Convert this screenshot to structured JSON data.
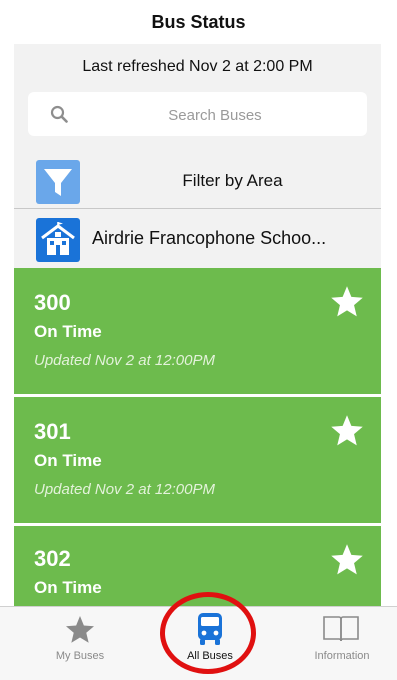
{
  "header": {
    "title": "Bus Status"
  },
  "status": {
    "last_refreshed": "Last refreshed Nov 2 at 2:00 PM"
  },
  "search": {
    "placeholder": "Search Buses",
    "value": ""
  },
  "filter": {
    "label": "Filter by Area"
  },
  "school": {
    "label": "Airdrie Francophone Schoo..."
  },
  "buses": [
    {
      "number": "300",
      "status": "On Time",
      "updated": "Updated Nov 2 at 12:00PM"
    },
    {
      "number": "301",
      "status": "On Time",
      "updated": "Updated Nov 2 at 12:00PM"
    },
    {
      "number": "302",
      "status": "On Time"
    }
  ],
  "tabs": [
    {
      "label": "My Buses",
      "icon": "star-icon",
      "active": false
    },
    {
      "label": "All Buses",
      "icon": "bus-icon",
      "active": true
    },
    {
      "label": "Information",
      "icon": "book-icon",
      "active": false
    }
  ],
  "colors": {
    "card_green": "#6dbb4d",
    "filter_blue": "#6aa7ea",
    "school_blue": "#1a73d8",
    "active_tab_blue": "#1a73d8",
    "highlight_red": "#e01010"
  }
}
